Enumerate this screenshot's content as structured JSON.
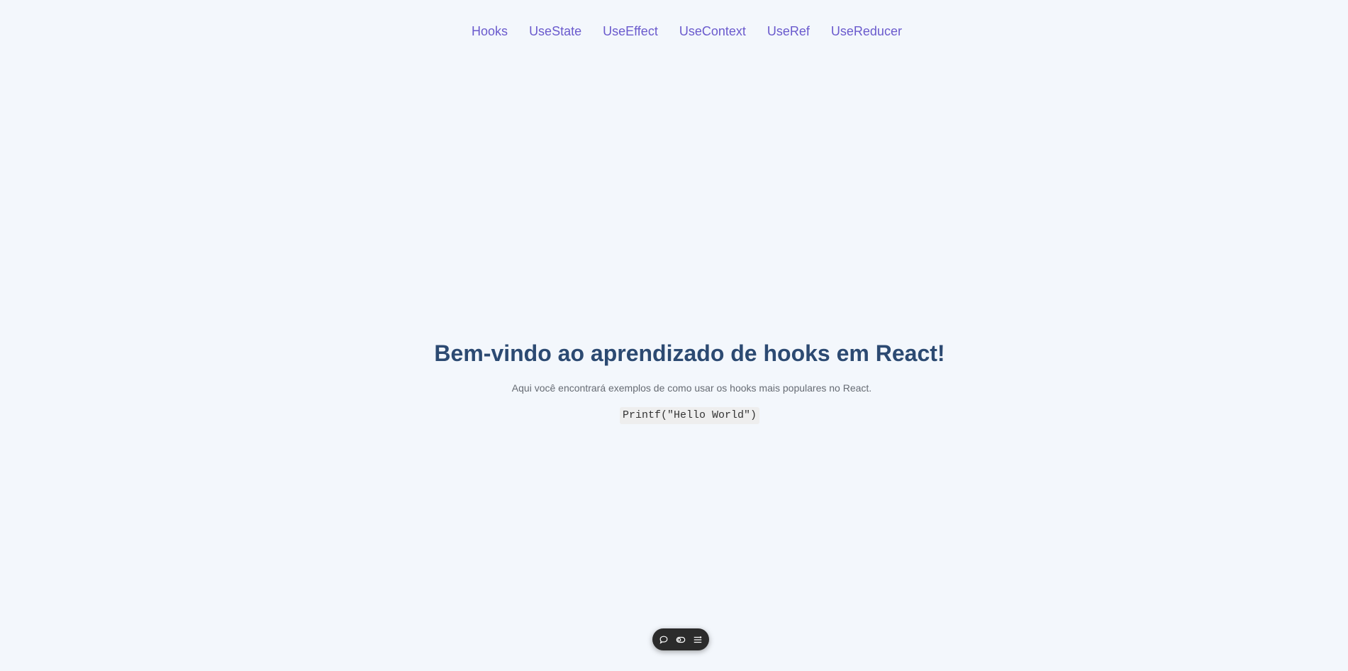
{
  "nav": {
    "items": [
      {
        "label": "Hooks"
      },
      {
        "label": "UseState"
      },
      {
        "label": "UseEffect"
      },
      {
        "label": "UseContext"
      },
      {
        "label": "UseRef"
      },
      {
        "label": "UseReducer"
      }
    ]
  },
  "hero": {
    "title": "Bem-vindo ao aprendizado de hooks em React!",
    "subtitle": "Aqui você encontrará exemplos de como usar os hooks mais populares no React.",
    "code": "Printf(\"Hello World\")"
  },
  "toolbar": {
    "icons": [
      "comment-icon",
      "toggle-icon",
      "menu-icon"
    ]
  },
  "colors": {
    "background": "#f3f7fc",
    "nav_link": "#6a5acd",
    "title": "#2c4a72",
    "toolbar_bg": "#2b2b2b"
  }
}
